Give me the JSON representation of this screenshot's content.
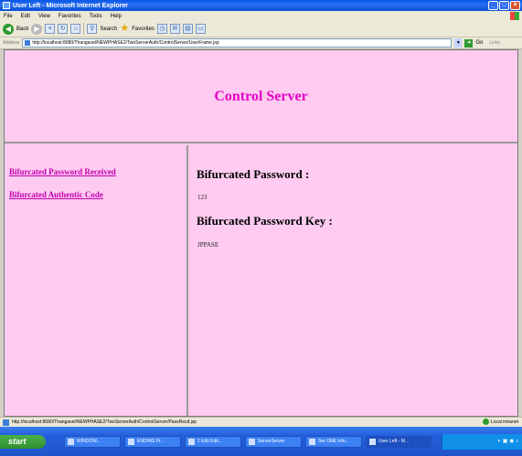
{
  "window": {
    "title": "User Left - Microsoft Internet Explorer",
    "buttons": {
      "minimize": "_",
      "maximize": "□",
      "close": "×"
    }
  },
  "menubar": {
    "items": [
      "File",
      "Edit",
      "View",
      "Favorites",
      "Tools",
      "Help"
    ]
  },
  "toolbar": {
    "back_label": "Back",
    "search_label": "Search",
    "favorites_label": "Favorites"
  },
  "addressbar": {
    "label": "Address",
    "url": "http://localhost:8080/Thangavel/NEWPHASE2/TwoServerAuth/ControlServer/UserFrame.jsp",
    "go_label": "Go",
    "links_label": "Links"
  },
  "page": {
    "heading": "Control Server",
    "nav_links": [
      "Bifurcated Password Received",
      "Bifurcated Authentic Code"
    ],
    "sections": [
      {
        "title": "Bifurcated Password :",
        "value": "123"
      },
      {
        "title": "Bifurcated Password Key :",
        "value": "JPPASE"
      }
    ],
    "background_color": "#ffcbf0",
    "heading_color": "#e600c8",
    "link_color": "#c000b0"
  },
  "statusbar": {
    "text": "http://localhost:8080/Thangavel/NEWPHASE2/TwoServerAuth/ControlServer/PassRecd.jsp",
    "zone": "Local intranet"
  },
  "taskbar": {
    "start_label": "start",
    "items": [
      "WINDOW...",
      "ENDING Pr...",
      "2 Edit Edit...",
      "ServerServer",
      "Ser ONE Info...",
      "User Left - M..."
    ],
    "active_index": 5
  }
}
